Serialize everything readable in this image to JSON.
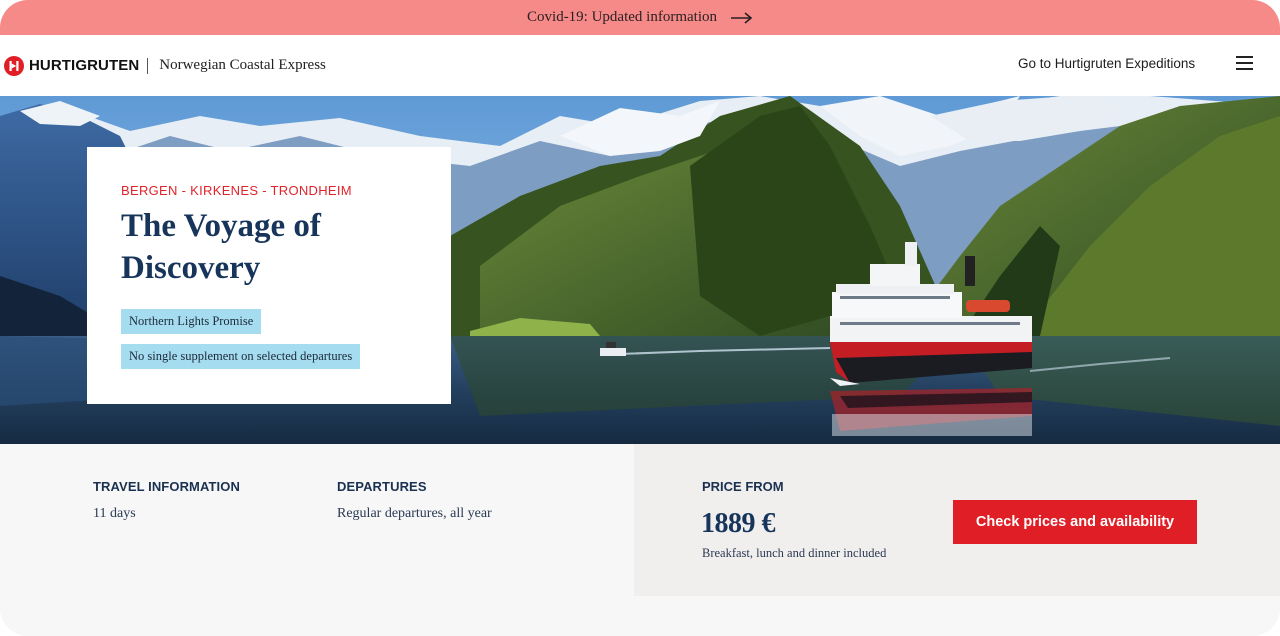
{
  "banner": {
    "text": "Covid-19: Updated information",
    "icon": "arrow-right-icon",
    "color": "#f58a88"
  },
  "header": {
    "brand": "HURTIGRUTEN",
    "sub_brand": "Norwegian Coastal Express",
    "link": "Go to Hurtigruten Expeditions",
    "menu_icon": "hamburger-menu-icon",
    "brand_color": "#e01e26"
  },
  "hero": {
    "route": "BERGEN - KIRKENES - TRONDHEIM",
    "title": "The Voyage of Discovery",
    "tags": [
      "Northern Lights Promise",
      "No single supplement on selected departures"
    ],
    "image_description": "Coastal Express ship sailing through a Norwegian fjord with snow-capped mountains"
  },
  "info": {
    "travel": {
      "label": "TRAVEL INFORMATION",
      "value": "11 days"
    },
    "departures": {
      "label": "DEPARTURES",
      "value": "Regular departures, all year"
    },
    "price": {
      "label": "PRICE FROM",
      "value": "1889 €",
      "note": "Breakfast, lunch and dinner included"
    },
    "cta_label": "Check prices and availability",
    "cta_color": "#e01e26"
  }
}
